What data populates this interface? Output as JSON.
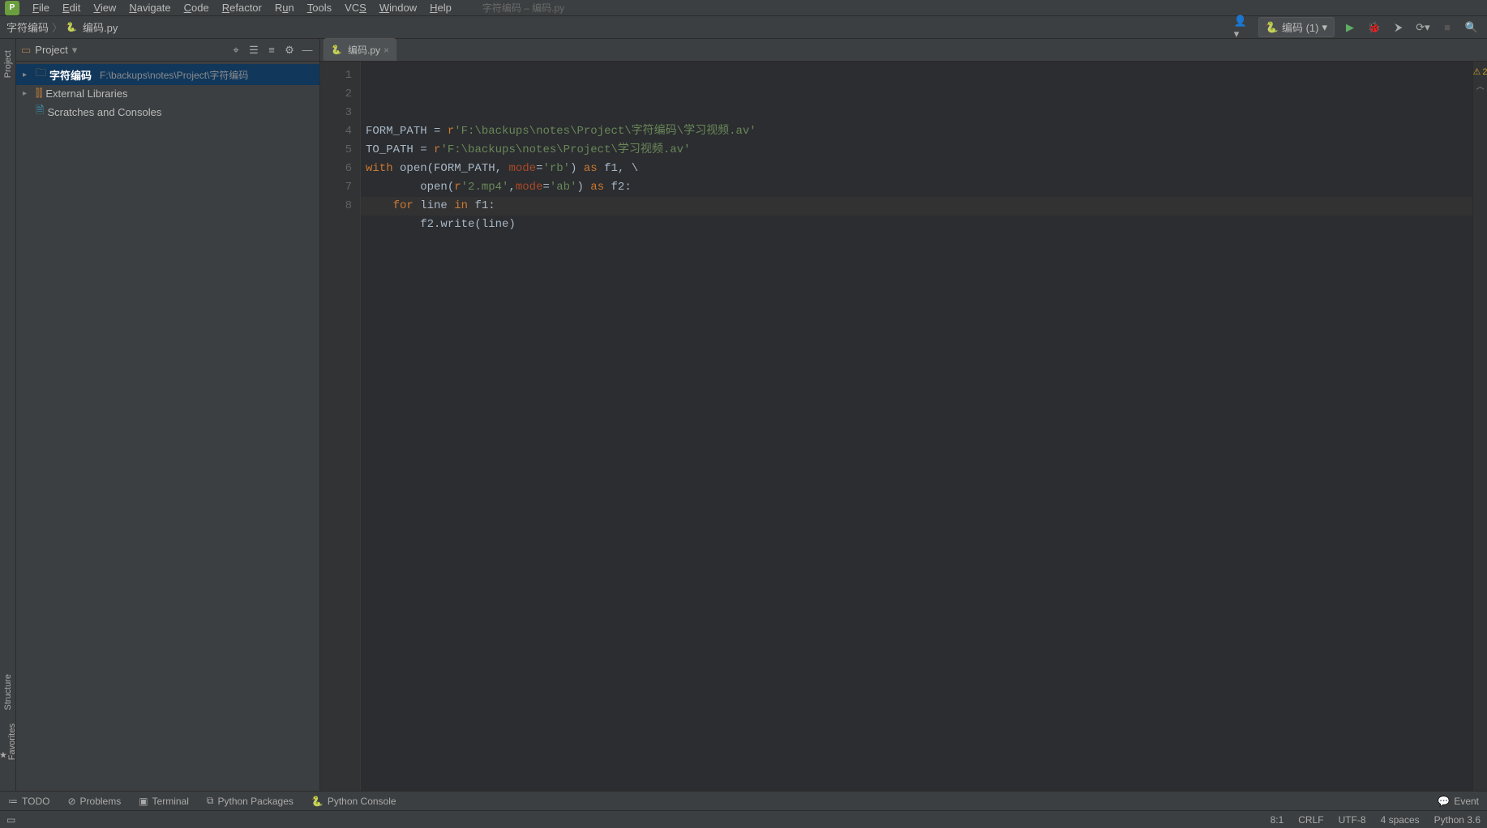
{
  "menu": {
    "items": [
      "File",
      "Edit",
      "View",
      "Navigate",
      "Code",
      "Refactor",
      "Run",
      "Tools",
      "VCS",
      "Window",
      "Help"
    ],
    "title": "字符编码 – 编码.py"
  },
  "breadcrumb": {
    "root": "字符编码",
    "file": "编码.py"
  },
  "toolbar": {
    "run_config_label": "编码 (1)"
  },
  "project": {
    "panel_title": "Project",
    "root": {
      "name": "字符编码",
      "path": "F:\\backups\\notes\\Project\\字符编码"
    },
    "external": "External Libraries",
    "scratches": "Scratches and Consoles"
  },
  "tabs": [
    {
      "label": "编码.py"
    }
  ],
  "code": {
    "lines": [
      {
        "n": 1,
        "segments": [
          [
            "var",
            "FORM_PATH"
          ],
          [
            "punc",
            " = "
          ],
          [
            "kw",
            "r"
          ],
          [
            "str",
            "'F:\\backups\\notes\\Project\\字符编码\\学习视频.av'"
          ]
        ]
      },
      {
        "n": 2,
        "segments": [
          [
            "var",
            "TO_PATH"
          ],
          [
            "punc",
            " = "
          ],
          [
            "kw",
            "r"
          ],
          [
            "str",
            "'F:\\backups\\notes\\Project\\学习视频.av'"
          ]
        ]
      },
      {
        "n": 3,
        "segments": [
          [
            "kw",
            "with"
          ],
          [
            "punc",
            " "
          ],
          [
            "fn",
            "open"
          ],
          [
            "punc",
            "(FORM_PATH"
          ],
          [
            "punc",
            ", "
          ],
          [
            "param",
            "mode"
          ],
          [
            "punc",
            "="
          ],
          [
            "str",
            "'rb'"
          ],
          [
            "punc",
            ") "
          ],
          [
            "kw",
            "as"
          ],
          [
            "punc",
            " f1"
          ],
          [
            "punc",
            ", "
          ],
          [
            "punc",
            "\\"
          ]
        ]
      },
      {
        "n": 4,
        "segments": [
          [
            "punc",
            "        "
          ],
          [
            "fn",
            "open"
          ],
          [
            "punc",
            "("
          ],
          [
            "kw",
            "r"
          ],
          [
            "str",
            "'2.mp4'"
          ],
          [
            "punc",
            ","
          ],
          [
            "param",
            "mode"
          ],
          [
            "punc",
            "="
          ],
          [
            "str",
            "'ab'"
          ],
          [
            "punc",
            ") "
          ],
          [
            "kw",
            "as"
          ],
          [
            "punc",
            " f2:"
          ]
        ]
      },
      {
        "n": 5,
        "segments": [
          [
            "punc",
            "    "
          ],
          [
            "kw",
            "for"
          ],
          [
            "punc",
            " line "
          ],
          [
            "kw",
            "in"
          ],
          [
            "punc",
            " f1:"
          ]
        ]
      },
      {
        "n": 6,
        "segments": [
          [
            "punc",
            "        f2.write(line)"
          ]
        ]
      },
      {
        "n": 7,
        "segments": [
          [
            "punc",
            ""
          ]
        ]
      },
      {
        "n": 8,
        "segments": [
          [
            "punc",
            ""
          ]
        ]
      }
    ]
  },
  "warnings": "2",
  "left_tools": {
    "project": "Project",
    "structure": "Structure",
    "favorites": "Favorites"
  },
  "bottom": {
    "todo": "TODO",
    "problems": "Problems",
    "terminal": "Terminal",
    "packages": "Python Packages",
    "console": "Python Console",
    "event": "Event"
  },
  "status": {
    "pos": "8:1",
    "eol": "CRLF",
    "enc": "UTF-8",
    "indent": "4 spaces",
    "sdk": "Python 3.6"
  }
}
